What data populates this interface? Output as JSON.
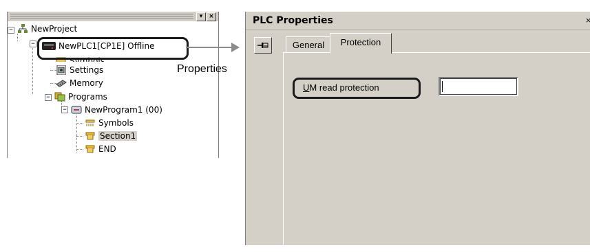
{
  "tree": {
    "items": [
      {
        "label": "NewProject",
        "icon": "network-icon"
      },
      {
        "label": "NewPLC1[CP1E] Offline",
        "icon": "plc-icon"
      },
      {
        "label": "Symbols",
        "icon": "symbols-icon"
      },
      {
        "label": "Settings",
        "icon": "settings-icon"
      },
      {
        "label": "Memory",
        "icon": "memory-icon"
      },
      {
        "label": "Programs",
        "icon": "programs-icon"
      },
      {
        "label": "NewProgram1 (00)",
        "icon": "program-icon"
      },
      {
        "label": "Symbols",
        "icon": "symbols-icon"
      },
      {
        "label": "Section1",
        "icon": "section-icon"
      },
      {
        "label": "END",
        "icon": "section-icon"
      }
    ],
    "selected_index": 8
  },
  "callout": {
    "label": "Properties"
  },
  "dialog": {
    "title": "PLC Properties",
    "close_glyph": "×",
    "tabs": [
      {
        "label": "General"
      },
      {
        "label": "Protection"
      }
    ],
    "active_tab": "Protection",
    "fields": {
      "um_read_protection": {
        "label_mnemonic": "U",
        "label_rest": "M read protection",
        "value": ""
      }
    }
  },
  "colors": {
    "dialog_bg": "#d4d0c8",
    "callout_border": "#1a1a1a",
    "arrow": "#8c8c8c"
  }
}
